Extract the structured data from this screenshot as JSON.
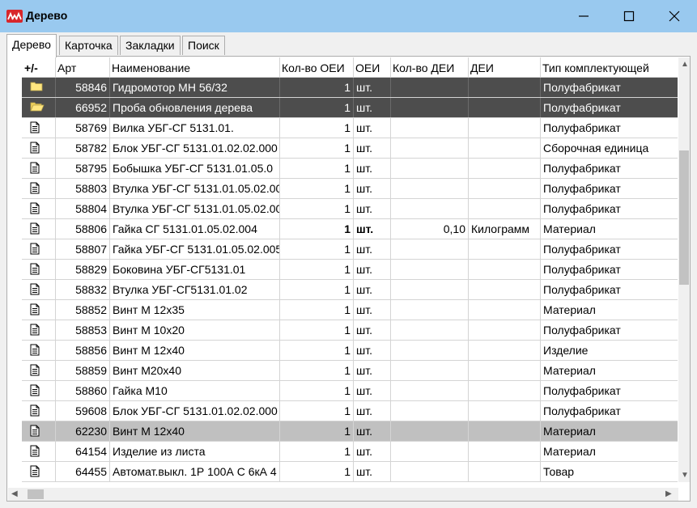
{
  "window": {
    "title": "Дерево"
  },
  "tabs": [
    {
      "label": "Дерево",
      "active": true
    },
    {
      "label": "Карточка",
      "active": false
    },
    {
      "label": "Закладки",
      "active": false
    },
    {
      "label": "Поиск",
      "active": false
    }
  ],
  "columns": {
    "toggle": "+/-",
    "art": "Арт",
    "name": "Наименование",
    "qty": "Кол-во ОЕИ",
    "unit": "ОЕИ",
    "qty2": "Кол-во ДЕИ",
    "unit2": "ДЕИ",
    "type": "Тип комплектующей"
  },
  "rows": [
    {
      "icon": "folder-icon",
      "art": "58846",
      "name": "Гидромотор   МН 56/32",
      "qty": "1",
      "unit": "шт.",
      "qty2": "",
      "unit2": "",
      "type": "Полуфабрикат",
      "state": "sel-dark",
      "bold": false,
      "current": false
    },
    {
      "icon": "folder-open-icon",
      "art": "66952",
      "name": "Проба обновления дерева",
      "qty": "1",
      "unit": "шт.",
      "qty2": "",
      "unit2": "",
      "type": "Полуфабрикат",
      "state": "sel-dark",
      "bold": false,
      "current": true
    },
    {
      "icon": "document-icon",
      "art": "58769",
      "name": "Вилка                УБГ-СГ 5131.01.",
      "qty": "1",
      "unit": "шт.",
      "qty2": "",
      "unit2": "",
      "type": "Полуфабрикат",
      "state": "",
      "bold": false,
      "current": false
    },
    {
      "icon": "document-icon",
      "art": "58782",
      "name": "Блок УБГ-СГ 5131.01.02.02.000",
      "qty": "1",
      "unit": "шт.",
      "qty2": "",
      "unit2": "",
      "type": "Сборочная единица",
      "state": "",
      "bold": false,
      "current": false
    },
    {
      "icon": "document-icon",
      "art": "58795",
      "name": "Бобышка   УБГ-СГ 5131.01.05.0",
      "qty": "1",
      "unit": "шт.",
      "qty2": "",
      "unit2": "",
      "type": "Полуфабрикат",
      "state": "",
      "bold": false,
      "current": false
    },
    {
      "icon": "document-icon",
      "art": "58803",
      "name": "Втулка УБГ-СГ 5131.01.05.02.00",
      "qty": "1",
      "unit": "шт.",
      "qty2": "",
      "unit2": "",
      "type": "Полуфабрикат",
      "state": "",
      "bold": false,
      "current": false
    },
    {
      "icon": "document-icon",
      "art": "58804",
      "name": "Втулка УБГ-СГ 5131.01.05.02.00",
      "qty": "1",
      "unit": "шт.",
      "qty2": "",
      "unit2": "",
      "type": "Полуфабрикат",
      "state": "",
      "bold": false,
      "current": false
    },
    {
      "icon": "document-icon",
      "art": "58806",
      "name": "Гайка СГ 5131.01.05.02.004",
      "qty": "1",
      "unit": "шт.",
      "qty2": "0,10",
      "unit2": "Килограмм",
      "type": "Материал",
      "state": "",
      "bold": true,
      "current": false
    },
    {
      "icon": "document-icon",
      "art": "58807",
      "name": "Гайка УБГ-СГ 5131.01.05.02.005",
      "qty": "1",
      "unit": "шт.",
      "qty2": "",
      "unit2": "",
      "type": "Полуфабрикат",
      "state": "",
      "bold": false,
      "current": false
    },
    {
      "icon": "document-icon",
      "art": "58829",
      "name": "Боковина           УБГ-СГ5131.01",
      "qty": "1",
      "unit": "шт.",
      "qty2": "",
      "unit2": "",
      "type": "Полуфабрикат",
      "state": "",
      "bold": false,
      "current": false
    },
    {
      "icon": "document-icon",
      "art": "58832",
      "name": "Втулка           УБГ-СГ5131.01.02",
      "qty": "1",
      "unit": "шт.",
      "qty2": "",
      "unit2": "",
      "type": "Полуфабрикат",
      "state": "",
      "bold": false,
      "current": false
    },
    {
      "icon": "document-icon",
      "art": "58852",
      "name": "Винт   М  12х35",
      "qty": "1",
      "unit": "шт.",
      "qty2": "",
      "unit2": "",
      "type": "Материал",
      "state": "",
      "bold": false,
      "current": false
    },
    {
      "icon": "document-icon",
      "art": "58853",
      "name": "Винт   М 10х20",
      "qty": "1",
      "unit": "шт.",
      "qty2": "",
      "unit2": "",
      "type": "Полуфабрикат",
      "state": "",
      "bold": false,
      "current": false
    },
    {
      "icon": "document-icon",
      "art": "58856",
      "name": "Винт    М 12х40",
      "qty": "1",
      "unit": "шт.",
      "qty2": "",
      "unit2": "",
      "type": "Изделие",
      "state": "",
      "bold": false,
      "current": false
    },
    {
      "icon": "document-icon",
      "art": "58859",
      "name": "Винт    М20х40",
      "qty": "1",
      "unit": "шт.",
      "qty2": "",
      "unit2": "",
      "type": "Материал",
      "state": "",
      "bold": false,
      "current": false
    },
    {
      "icon": "document-icon",
      "art": "58860",
      "name": "Гайка М10",
      "qty": "1",
      "unit": "шт.",
      "qty2": "",
      "unit2": "",
      "type": "Полуфабрикат",
      "state": "",
      "bold": false,
      "current": false
    },
    {
      "icon": "document-icon",
      "art": "59608",
      "name": "Блок УБГ-СГ 5131.01.02.02.000",
      "qty": "1",
      "unit": "шт.",
      "qty2": "",
      "unit2": "",
      "type": "Полуфабрикат",
      "state": "",
      "bold": false,
      "current": false
    },
    {
      "icon": "document-icon",
      "art": "62230",
      "name": "Винт М 12х40",
      "qty": "1",
      "unit": "шт.",
      "qty2": "",
      "unit2": "",
      "type": "Материал",
      "state": "sel-light",
      "bold": false,
      "current": false
    },
    {
      "icon": "document-icon",
      "art": "64154",
      "name": "Изделие из листа",
      "qty": "1",
      "unit": "шт.",
      "qty2": "",
      "unit2": "",
      "type": "Материал",
      "state": "",
      "bold": false,
      "current": false
    },
    {
      "icon": "document-icon",
      "art": "64455",
      "name": "Автомат.выкл. 1Р 100А С 6кА 4",
      "qty": "1",
      "unit": "шт.",
      "qty2": "",
      "unit2": "",
      "type": "Товар",
      "state": "",
      "bold": false,
      "current": false
    }
  ],
  "colors": {
    "titlebar": "#99c9ef",
    "selected_dark": "#4d4d4d",
    "selected_light": "#c0c0c0",
    "folder": "#ffe680"
  }
}
